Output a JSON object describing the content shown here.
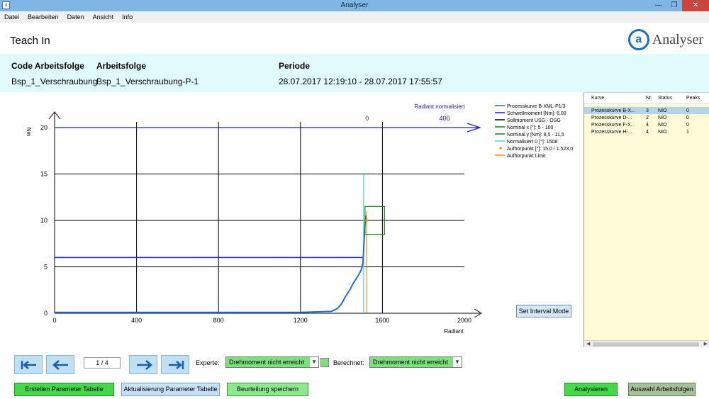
{
  "window": {
    "title": "Analyser"
  },
  "menu": [
    "Datei",
    "Bearbeiten",
    "Daten",
    "Ansicht",
    "Info"
  ],
  "header": {
    "page_title": "Teach In",
    "logo_text": "Analyser"
  },
  "info": {
    "code_label": "Code Arbeitsfolge",
    "code_value": "Bsp_1_Verschraubung",
    "af_label": "Arbeitsfolge",
    "af_value": "Bsp_1_Verschraubung-P-1",
    "period_label": "Periode",
    "period_value": "28.07.2017 12:19:10  -  28.07.2017 17:55:57"
  },
  "chart_data": {
    "type": "line",
    "ylabel": "Nm",
    "xlabel": "Radiant",
    "top_axis_label": "Radiant normalisiert",
    "xlim": [
      0,
      2000
    ],
    "ylim": [
      0,
      20
    ],
    "x_ticks": [
      0,
      400,
      800,
      1200,
      1600,
      2000
    ],
    "y_ticks": [
      0,
      5,
      10,
      15,
      20
    ],
    "top_ticks": [
      "0",
      "400"
    ],
    "legend": [
      {
        "label": "Prozesskurve B-XML-P1/3",
        "color": "#1f6fd6",
        "kind": "line"
      },
      {
        "label": "Schwellmoment [Nm]: 6,00",
        "color": "#1a1ad6",
        "kind": "line"
      },
      {
        "label": "Sollmoment USG - OSG",
        "color": "#000000",
        "kind": "line"
      },
      {
        "label": "Nominal x [°]: 5 - 100",
        "color": "#1a7a1a",
        "kind": "line"
      },
      {
        "label": "Nominal y [Nm]: 8,5 - 11,5",
        "color": "#1a7a1a",
        "kind": "line"
      },
      {
        "label": "Normalisiert 0 [°]: 1508",
        "color": "#4fd6e0",
        "kind": "line"
      },
      {
        "label": "Aufhörpunkt [°]: 15,0 / 1.523,0",
        "color": "#ff8a1a",
        "kind": "dot"
      },
      {
        "label": "Aufhörpunkt Limit",
        "color": "#ff8a1a",
        "kind": "line"
      }
    ],
    "series": [
      {
        "name": "Prozesskurve B-XML-P1/3",
        "x": [
          0,
          200,
          400,
          600,
          800,
          1000,
          1200,
          1350,
          1380,
          1400,
          1420,
          1440,
          1460,
          1480,
          1495,
          1505,
          1510,
          1515,
          1520
        ],
        "y": [
          0.1,
          0.1,
          0.1,
          0.1,
          0.1,
          0.1,
          0.1,
          0.2,
          0.5,
          1.0,
          1.8,
          2.5,
          3.3,
          4.0,
          4.6,
          5.4,
          7.5,
          9.5,
          10.5
        ]
      }
    ],
    "threshold_y": 6.0,
    "upper_line_y": 20,
    "normalized_x": 1508,
    "normalized_top_y": 15,
    "stop_point": {
      "x": 1523,
      "y": 15.0
    },
    "nominal_box": {
      "x0": 1515,
      "x1": 1610,
      "y0": 8.5,
      "y1": 11.5
    },
    "colors": {
      "curve": "#1f6fd6",
      "threshold": "#1a1ad6",
      "normalized": "#4fd6e0",
      "stop": "#ff8a1a",
      "nominal": "#1a7a1a",
      "grid": "#000000"
    }
  },
  "list": {
    "headers": [
      "Kurve",
      "Nr.",
      "Status",
      "Peaks"
    ],
    "rows": [
      [
        "Prozesskurve B-X...",
        "3",
        "NIO",
        "0"
      ],
      [
        "Prozesskurve D-...",
        "2",
        "NIO",
        "0"
      ],
      [
        "Prozesskurve F-X...",
        "4",
        "NIO",
        "0"
      ],
      [
        "Prozesskurve H-...",
        "4",
        "NIO",
        "1"
      ]
    ]
  },
  "interval_button": "Set Interval Mode",
  "pager": {
    "value": "1 / 4"
  },
  "experte": {
    "label": "Experte:",
    "value": "Drehmoment nicht erreicht"
  },
  "berechnet": {
    "label": "Berechnet:",
    "value": "Drehmoment nicht erreicht"
  },
  "buttons": {
    "create_table": "Erstellen Parameter Tabelle",
    "update_table": "Aktualisierung Parameter Tabelle",
    "save_rating": "Beurteilung speichern",
    "analyze": "Analysieren",
    "select_af": "Auswahl Arbeitsfolgen"
  }
}
